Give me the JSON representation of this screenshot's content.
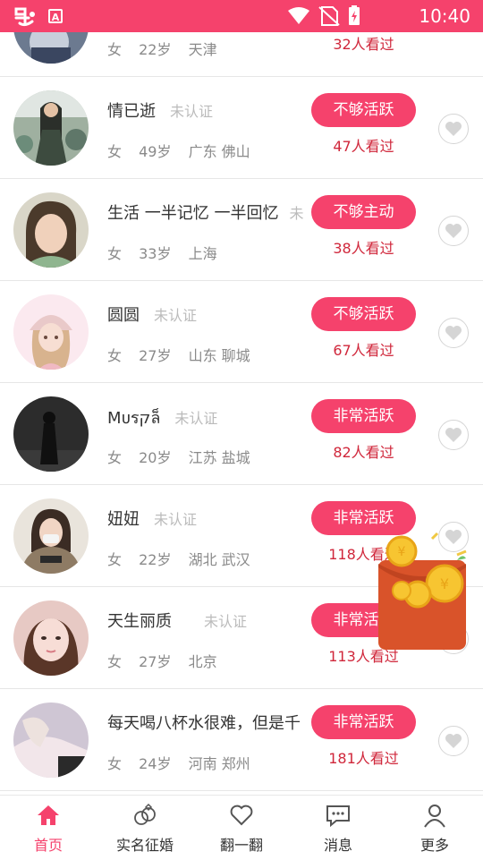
{
  "status_bar": {
    "time": "10:40",
    "icons": [
      "app-logo-icon",
      "a-notification-icon",
      "wifi-icon",
      "no-sim-icon",
      "battery-charging-icon"
    ]
  },
  "list": {
    "rows": [
      {
        "name": "",
        "unverified": "",
        "gender": "女",
        "age": "22岁",
        "location": "天津",
        "badge": "",
        "views": "32人看过"
      },
      {
        "name": "情已逝",
        "unverified": "未认证",
        "gender": "女",
        "age": "49岁",
        "location": "广东 佛山",
        "badge": "不够活跃",
        "views": "47人看过"
      },
      {
        "name": "生活 一半记忆 一半回忆",
        "unverified": "未",
        "gender": "女",
        "age": "33岁",
        "location": "上海",
        "badge": "不够主动",
        "views": "38人看过"
      },
      {
        "name": "圆圆",
        "unverified": "未认证",
        "gender": "女",
        "age": "27岁",
        "location": "山东 聊城",
        "badge": "不够活跃",
        "views": "67人看过"
      },
      {
        "name": "Mᴜรקล็",
        "unverified": "未认证",
        "gender": "女",
        "age": "20岁",
        "location": "江苏 盐城",
        "badge": "非常活跃",
        "views": "82人看过"
      },
      {
        "name": "妞妞",
        "unverified": "未认证",
        "gender": "女",
        "age": "22岁",
        "location": "湖北 武汉",
        "badge": "非常活跃",
        "views": "118人看过"
      },
      {
        "name": "天生丽质",
        "unverified": "未认证",
        "gender": "女",
        "age": "27岁",
        "location": "北京",
        "badge": "非常活跃",
        "views": "113人看过"
      },
      {
        "name": "每天喝八杯水很难，但是千",
        "unverified": "",
        "gender": "女",
        "age": "24岁",
        "location": "河南 郑州",
        "badge": "非常活跃",
        "views": "181人看过"
      }
    ]
  },
  "bottom_nav": {
    "items": [
      {
        "label": "首页",
        "icon": "home-icon",
        "active": true
      },
      {
        "label": "实名征婚",
        "icon": "marriage-rings-icon",
        "active": false
      },
      {
        "label": "翻一翻",
        "icon": "heart-outline-icon",
        "active": false
      },
      {
        "label": "消息",
        "icon": "message-icon",
        "active": false
      },
      {
        "label": "更多",
        "icon": "person-icon",
        "active": false
      }
    ]
  },
  "colors": {
    "accent": "#f5426c",
    "views_text": "#d0273b",
    "unverified_text": "#bbbbbb",
    "meta_text": "#8a8a8a"
  }
}
